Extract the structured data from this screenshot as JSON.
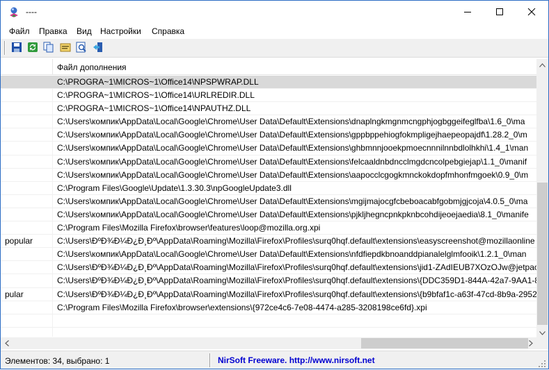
{
  "window": {
    "title": "----"
  },
  "menu": [
    "Файл",
    "Правка",
    "Вид",
    "Настройки",
    "Справка"
  ],
  "toolbar": {
    "icons": [
      "save-icon",
      "refresh-icon",
      "copy-icon",
      "properties-icon",
      "find-icon",
      "exit-icon"
    ]
  },
  "list": {
    "header": "Файл дополнения",
    "rows": [
      {
        "c1": "",
        "c2": "C:\\PROGRA~1\\MICROS~1\\Office14\\NPSPWRAP.DLL",
        "selected": true
      },
      {
        "c1": "",
        "c2": "C:\\PROGRA~1\\MICROS~1\\Office14\\URLREDIR.DLL"
      },
      {
        "c1": "",
        "c2": "C:\\PROGRA~1\\MICROS~1\\Office14\\NPAUTHZ.DLL"
      },
      {
        "c1": "",
        "c2": "C:\\Users\\компик\\AppData\\Local\\Google\\Chrome\\User Data\\Default\\Extensions\\dnaplngkmgnmcngphjogbggeifeglfba\\1.6_0\\ma"
      },
      {
        "c1": "",
        "c2": "C:\\Users\\компик\\AppData\\Local\\Google\\Chrome\\User Data\\Default\\Extensions\\gppbppehiogfokmpligejhaepeopajdf\\1.28.2_0\\m"
      },
      {
        "c1": "",
        "c2": "C:\\Users\\компик\\AppData\\Local\\Google\\Chrome\\User Data\\Default\\Extensions\\ghbmnnjooekpmoecnnnilnnbdlolhkhi\\1.4_1\\man"
      },
      {
        "c1": "",
        "c2": "C:\\Users\\компик\\AppData\\Local\\Google\\Chrome\\User Data\\Default\\Extensions\\felcaaldnbdncclmgdcncolpebgiejap\\1.1_0\\manif"
      },
      {
        "c1": "",
        "c2": "C:\\Users\\компик\\AppData\\Local\\Google\\Chrome\\User Data\\Default\\Extensions\\aapocclcgogkmnckokdopfmhonfmgoek\\0.9_0\\m"
      },
      {
        "c1": "",
        "c2": "C:\\Program Files\\Google\\Update\\1.3.30.3\\npGoogleUpdate3.dll"
      },
      {
        "c1": "",
        "c2": "C:\\Users\\компик\\AppData\\Local\\Google\\Chrome\\User Data\\Default\\Extensions\\mgijmajocgfcbeboacabfgobmjgjcoja\\4.0.5_0\\ma"
      },
      {
        "c1": "",
        "c2": "C:\\Users\\компик\\AppData\\Local\\Google\\Chrome\\User Data\\Default\\Extensions\\pjkljhegncpnkpknbcohdijeoejaedia\\8.1_0\\manife"
      },
      {
        "c1": "",
        "c2": "C:\\Program Files\\Mozilla Firefox\\browser\\features\\loop@mozilla.org.xpi"
      },
      {
        "c1": "popular",
        "c2": "C:\\Users\\ÐºÐ¾Ð¼Ð¿Ð¸Ðº\\AppData\\Roaming\\Mozilla\\Firefox\\Profiles\\surq0hqf.default\\extensions\\easyscreenshot@mozillaonline"
      },
      {
        "c1": "",
        "c2": "C:\\Users\\компик\\AppData\\Local\\Google\\Chrome\\User Data\\Default\\Extensions\\nfdfiepdkbnoanddpianalelglmfooik\\1.2.1_0\\man"
      },
      {
        "c1": "",
        "c2": "C:\\Users\\ÐºÐ¾Ð¼Ð¿Ð¸Ðº\\AppData\\Roaming\\Mozilla\\Firefox\\Profiles\\surq0hqf.default\\extensions\\jid1-ZAdIEUB7XOzOJw@jetpac"
      },
      {
        "c1": "",
        "c2": "C:\\Users\\ÐºÐ¾Ð¼Ð¿Ð¸Ðº\\AppData\\Roaming\\Mozilla\\Firefox\\Profiles\\surq0hqf.default\\extensions\\{DDC359D1-844A-42a7-9AA1-8"
      },
      {
        "c1": "pular",
        "c2": "C:\\Users\\ÐºÐ¾Ð¼Ð¿Ð¸Ðº\\AppData\\Roaming\\Mozilla\\Firefox\\Profiles\\surq0hqf.default\\extensions\\{b9bfaf1c-a63f-47cd-8b9a-2952"
      },
      {
        "c1": "",
        "c2": "C:\\Program Files\\Mozilla Firefox\\browser\\extensions\\{972ce4c6-7e08-4474-a285-3208198ce6fd}.xpi"
      },
      {
        "c1": "",
        "c2": ""
      },
      {
        "c1": "",
        "c2": ""
      }
    ]
  },
  "status": {
    "left": "Элементов: 34, выбрано: 1",
    "link": "NirSoft Freeware.  http://www.nirsoft.net"
  }
}
